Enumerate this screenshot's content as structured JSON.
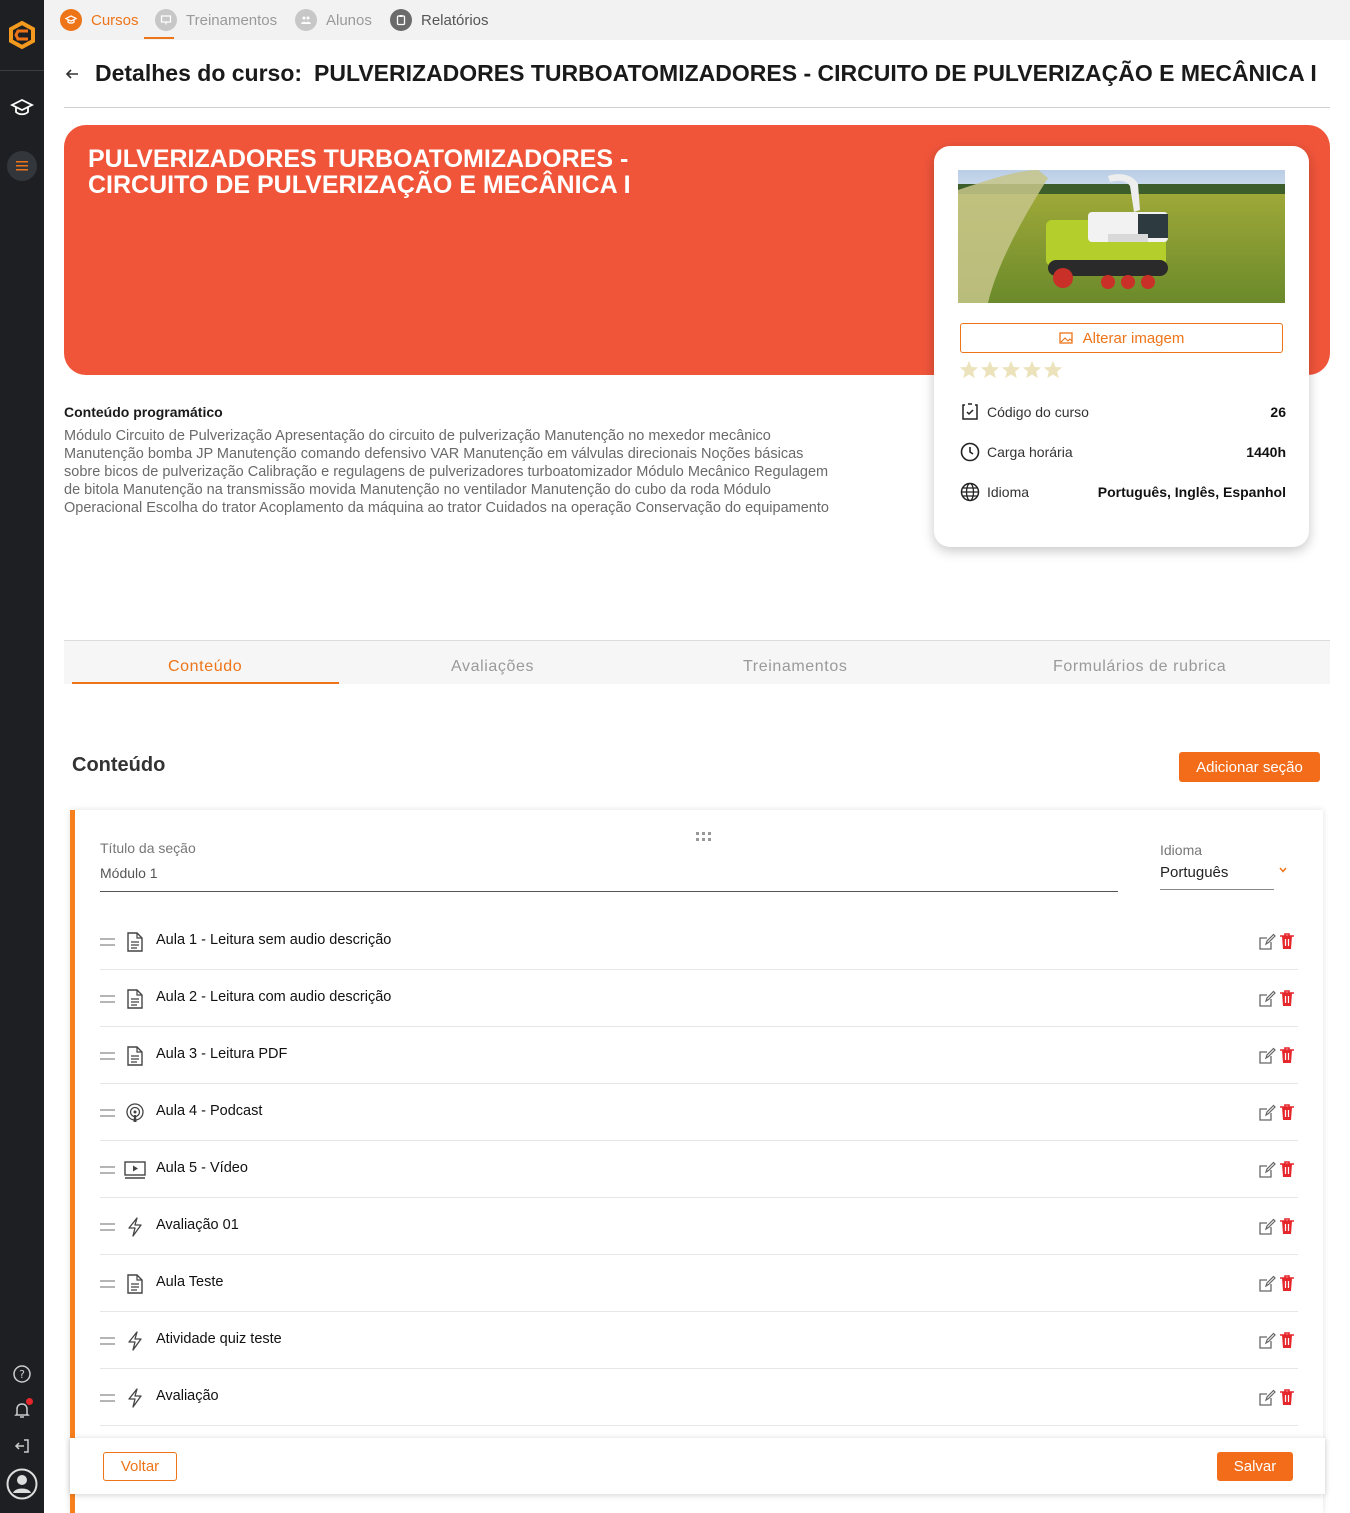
{
  "nav": {
    "items": [
      {
        "label": "Cursos",
        "icon": "graduation-cap-icon"
      },
      {
        "label": "Treinamentos",
        "icon": "presentation-icon"
      },
      {
        "label": "Alunos",
        "icon": "students-icon"
      },
      {
        "label": "Relatórios",
        "icon": "clipboard-icon"
      }
    ]
  },
  "header": {
    "prefix": "Detalhes do curso:",
    "course_name": "PULVERIZADORES TURBOATOMIZADORES - CIRCUITO DE PULVERIZAÇÃO E MECÂNICA I"
  },
  "banner": {
    "title": "PULVERIZADORES TURBOATOMIZADORES - CIRCUITO DE PULVERIZAÇÃO E MECÂNICA I",
    "color": "#f0553a"
  },
  "card": {
    "change_image_label": "Alterar imagem",
    "rating": 0,
    "rows": [
      {
        "label": "Código do curso",
        "value": "26",
        "icon": "code-icon"
      },
      {
        "label": "Carga horária",
        "value": "1440h",
        "icon": "clock-icon"
      },
      {
        "label": "Idioma",
        "value": "Português, Inglês, Espanhol",
        "icon": "globe-icon"
      }
    ]
  },
  "program": {
    "title": "Conteúdo programático",
    "text": "Módulo Circuito de Pulverização Apresentação do circuito de pulverização Manutenção no mexedor mecânico Manutenção bomba JP Manutenção comando defensivo VAR Manutenção em válvulas direcionais Noções básicas sobre bicos de pulverização Calibração e regulagens de pulverizadores turboatomizador Módulo Mecânico Regulagem de bitola Manutenção na transmissão movida Manutenção no ventilador Manutenção do cubo da roda Módulo Operacional Escolha do trator Acoplamento da máquina ao trator Cuidados na operação Conservação do equipamento"
  },
  "tabs": [
    "Conteúdo",
    "Avaliações",
    "Treinamentos",
    "Formulários de rubrica"
  ],
  "content": {
    "heading": "Conteúdo",
    "add_section_label": "Adicionar seção",
    "section": {
      "title_label": "Título da seção",
      "title_value": "Módulo 1",
      "lang_label": "Idioma",
      "lang_value": "Português",
      "lessons": [
        {
          "title": "Aula 1 - Leitura sem audio descrição",
          "icon": "document-icon"
        },
        {
          "title": "Aula 2 - Leitura com audio descrição",
          "icon": "document-icon"
        },
        {
          "title": "Aula 3 - Leitura PDF",
          "icon": "document-icon"
        },
        {
          "title": "Aula 4 - Podcast",
          "icon": "podcast-icon"
        },
        {
          "title": "Aula 5 - Vídeo",
          "icon": "video-icon"
        },
        {
          "title": "Avaliação 01",
          "icon": "lightning-icon"
        },
        {
          "title": "Aula Teste",
          "icon": "document-icon"
        },
        {
          "title": "Atividade quiz teste",
          "icon": "lightning-icon"
        },
        {
          "title": "Avaliação",
          "icon": "lightning-icon"
        }
      ]
    }
  },
  "footer": {
    "back_label": "Voltar",
    "save_label": "Salvar"
  },
  "colors": {
    "accent": "#ee7418",
    "sidebar": "#1d1f23",
    "delete": "#e5262b"
  }
}
